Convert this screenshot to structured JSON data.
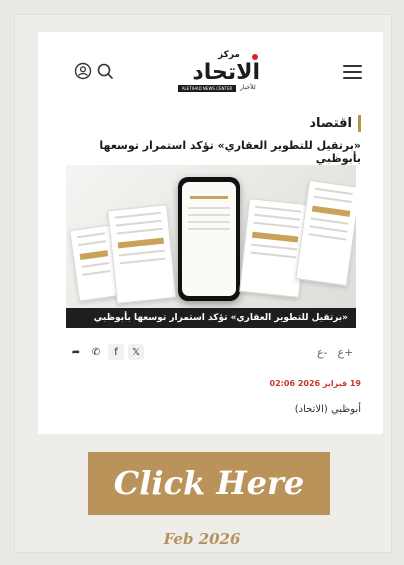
{
  "header": {
    "logo_main": "الاتحاد",
    "logo_small": "مركز",
    "logo_bar": "ALETIHAD NEWS CENTER",
    "logo_sub": "للأخبار"
  },
  "article": {
    "section": "اقتصاد",
    "headline": "«برتقيل للتطوير العقاري» تؤكد استمرار توسعها بأبوظبي",
    "image_caption": "«برتقيل للتطوير العقاري» تؤكد استمرار توسعها بأبوظبي",
    "date": "19 فبراير 2026 02:06",
    "author": "أبوظبي (الاتحاد)",
    "font_increase": "+ع",
    "font_decrease": "-ع"
  },
  "share": {
    "x_label": "𝕏",
    "facebook_label": "f",
    "whatsapp_label": "✆",
    "forward_label": "➦"
  },
  "cta": {
    "label": "Click Here",
    "date": "Feb 2026"
  },
  "colors": {
    "accent_gold": "#b9935a",
    "date_red": "#c23a2e",
    "logo_red_dot": "#d7262b"
  }
}
